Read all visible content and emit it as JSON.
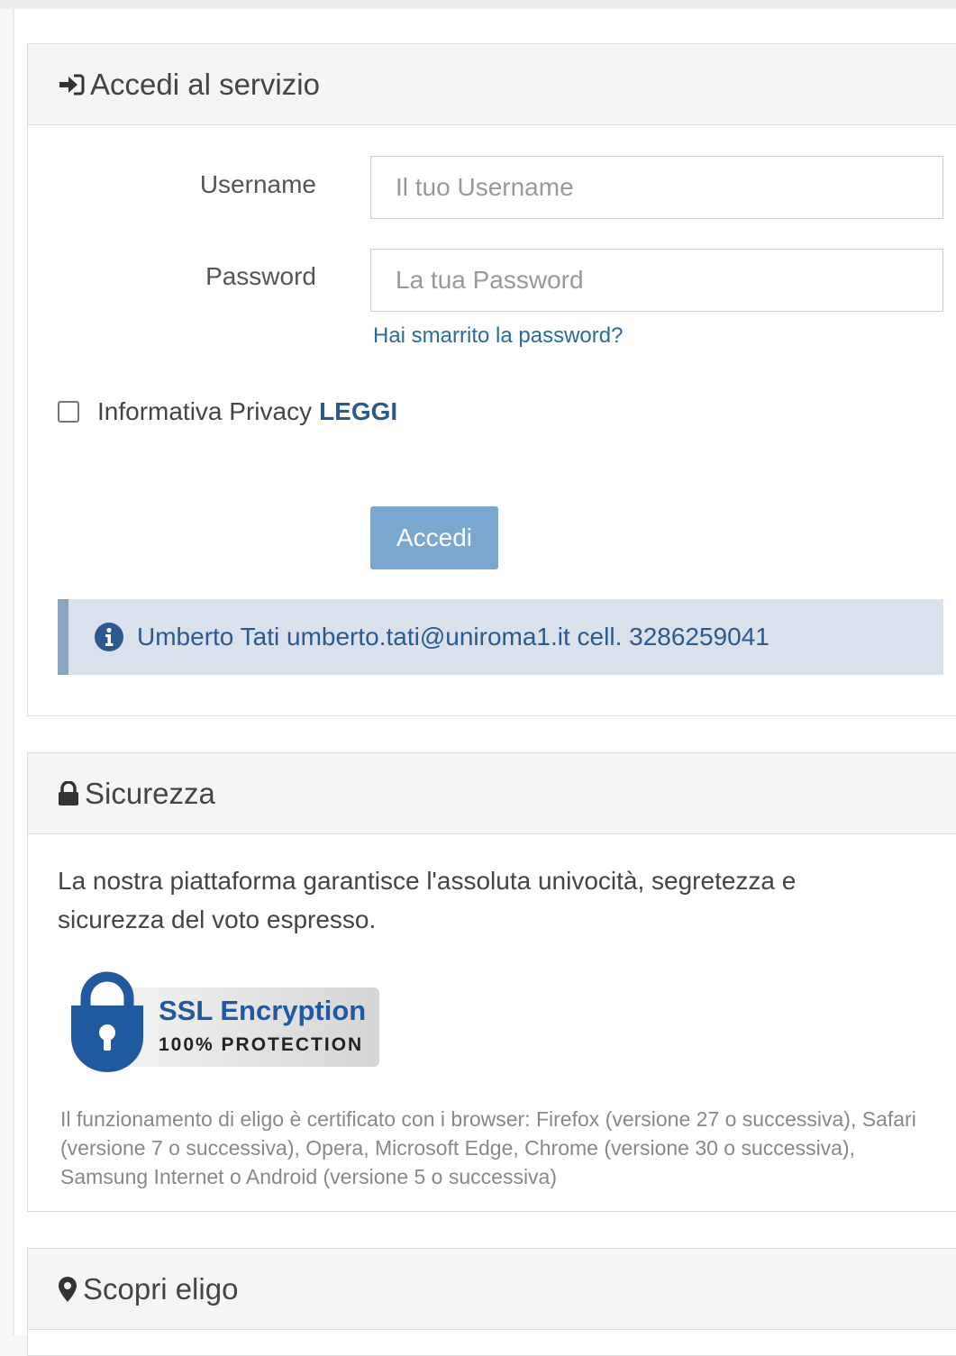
{
  "login": {
    "title": "Accedi al servizio",
    "username_label": "Username",
    "username_placeholder": "Il tuo Username",
    "password_label": "Password",
    "password_placeholder": "La tua Password",
    "forgot_link": "Hai smarrito la password?",
    "privacy_label": "Informativa Privacy",
    "privacy_link": "LEGGI",
    "submit_label": "Accedi",
    "contact_info": "Umberto Tati umberto.tati@uniroma1.it cell. 3286259041"
  },
  "security": {
    "title": "Sicurezza",
    "description": "La nostra piattaforma garantisce l'assoluta univocità, segretezza e sicurezza del voto espresso.",
    "badge_title": "SSL Encryption",
    "badge_subtitle": "100% PROTECTION",
    "compatibility": "Il funzionamento di eligo è certificato con i browser: Firefox (versione 27 o successiva), Safari (versione 7 o successiva), Opera, Microsoft Edge, Chrome (versione 30 o successiva), Samsung Internet o Android (versione 5 o successiva)"
  },
  "discover": {
    "title": "Scopri eligo"
  },
  "icons": {
    "login": "sign-in-icon",
    "security": "lock-icon",
    "discover": "map-marker-icon",
    "info": "info-circle-icon"
  },
  "colors": {
    "link": "#2b6a9c",
    "button": "#7aa7d0",
    "info_bg": "#d9e2ec",
    "info_border": "#8aa5c0",
    "badge_blue": "#1f5aa0"
  }
}
